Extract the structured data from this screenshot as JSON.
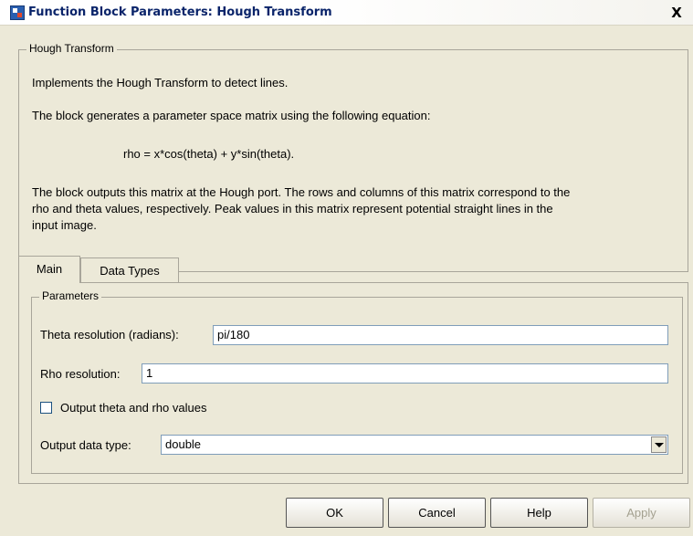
{
  "window": {
    "title": "Function Block Parameters: Hough Transform",
    "close_label": "X"
  },
  "description": {
    "group_label": "Hough Transform",
    "line1": "Implements the Hough Transform to detect lines.",
    "line2": "The block generates a parameter space matrix using the following equation:",
    "equation": "rho = x*cos(theta) + y*sin(theta).",
    "line3a": "The block outputs this matrix at the Hough port. The rows and columns of this matrix correspond to the",
    "line3b": "rho and theta values, respectively. Peak values in this matrix represent potential straight lines in the",
    "line3c": "input image."
  },
  "tabs": [
    {
      "label": "Main",
      "active": true
    },
    {
      "label": "Data Types",
      "active": false
    }
  ],
  "parameters": {
    "group_label": "Parameters",
    "theta_label": "Theta resolution (radians):",
    "theta_value": "pi/180",
    "rho_label": "Rho resolution:",
    "rho_value": "1",
    "output_checkbox_label": "Output theta and rho values",
    "output_checkbox_checked": false,
    "data_type_label": "Output data type:",
    "data_type_value": "double"
  },
  "buttons": {
    "ok": "OK",
    "cancel": "Cancel",
    "help": "Help",
    "apply": "Apply"
  }
}
